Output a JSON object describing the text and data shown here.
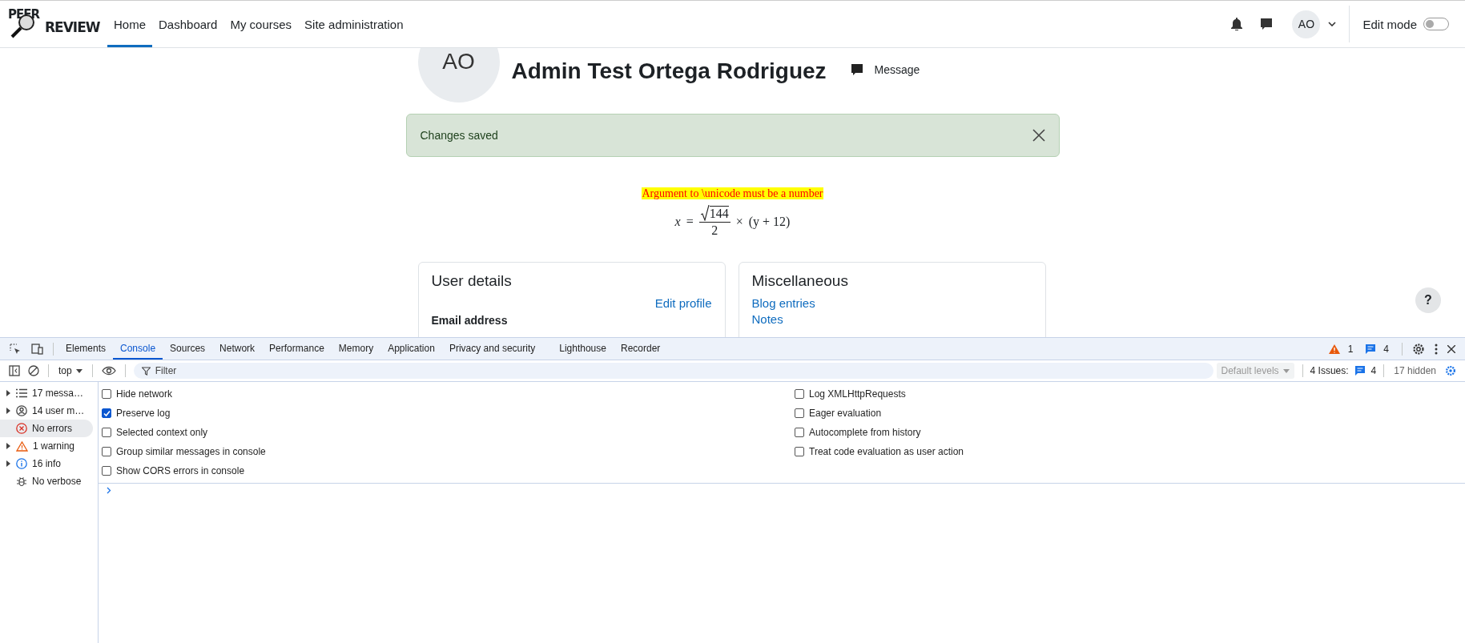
{
  "nav": {
    "logo_text": [
      "PEER",
      "REVIEW"
    ],
    "links": [
      {
        "label": "Home",
        "selected": true
      },
      {
        "label": "Dashboard",
        "selected": false
      },
      {
        "label": "My courses",
        "selected": false
      },
      {
        "label": "Site administration",
        "selected": false
      }
    ],
    "user_initials": "AO",
    "edit_mode": {
      "label": "Edit mode",
      "on": false
    }
  },
  "profile": {
    "initials": "AO",
    "name": "Admin Test Ortega Rodriguez",
    "message_label": "Message"
  },
  "alert": {
    "text": "Changes saved"
  },
  "help_label": "?",
  "math_error": "Argument to \\unicode must be a number",
  "formula": {
    "lhs": "x",
    "equals": "=",
    "radicand": "144",
    "denominator": "2",
    "operator": "×",
    "rhs": "(y + 12)"
  },
  "cards": [
    {
      "title": "User details",
      "items": [
        {
          "kind": "action",
          "text": "Edit profile"
        },
        {
          "kind": "label",
          "text": "Email address"
        }
      ]
    },
    {
      "title": "Miscellaneous",
      "items": [
        {
          "kind": "link",
          "text": "Blog entries"
        },
        {
          "kind": "link",
          "text": "Notes"
        }
      ]
    }
  ],
  "devtools": {
    "tabs": [
      {
        "label": "Elements",
        "selected": false
      },
      {
        "label": "Console",
        "selected": true
      },
      {
        "label": "Sources",
        "selected": false
      },
      {
        "label": "Network",
        "selected": false
      },
      {
        "label": "Performance",
        "selected": false
      },
      {
        "label": "Memory",
        "selected": false
      },
      {
        "label": "Application",
        "selected": false
      },
      {
        "label": "Privacy and security",
        "selected": false
      },
      {
        "label": "Lighthouse",
        "selected": false
      },
      {
        "label": "Recorder",
        "selected": false
      }
    ],
    "warning_count": "1",
    "message_count": "4",
    "context": "top",
    "filter_placeholder": "Filter",
    "levels": "Default levels",
    "issues_label": "4 Issues:",
    "issues_count": "4",
    "hidden": "17 hidden",
    "sidebar": [
      {
        "label": "17 messa…",
        "kind": "list",
        "expandable": true,
        "selected": false
      },
      {
        "label": "14 user m…",
        "kind": "user",
        "expandable": true,
        "selected": false
      },
      {
        "label": "No errors",
        "kind": "error",
        "expandable": false,
        "selected": true
      },
      {
        "label": "1 warning",
        "kind": "warning",
        "expandable": true,
        "selected": false
      },
      {
        "label": "16 info",
        "kind": "info",
        "expandable": true,
        "selected": false
      },
      {
        "label": "No verbose",
        "kind": "bug",
        "expandable": false,
        "selected": false
      }
    ],
    "settings_left": [
      {
        "label": "Hide network",
        "checked": false
      },
      {
        "label": "Preserve log",
        "checked": true
      },
      {
        "label": "Selected context only",
        "checked": false
      },
      {
        "label": "Group similar messages in console",
        "checked": false
      },
      {
        "label": "Show CORS errors in console",
        "checked": false
      }
    ],
    "settings_right": [
      {
        "label": "Log XMLHttpRequests",
        "checked": false
      },
      {
        "label": "Eager evaluation",
        "checked": false
      },
      {
        "label": "Autocomplete from history",
        "checked": false
      },
      {
        "label": "Treat code evaluation as user action",
        "checked": false
      }
    ]
  }
}
